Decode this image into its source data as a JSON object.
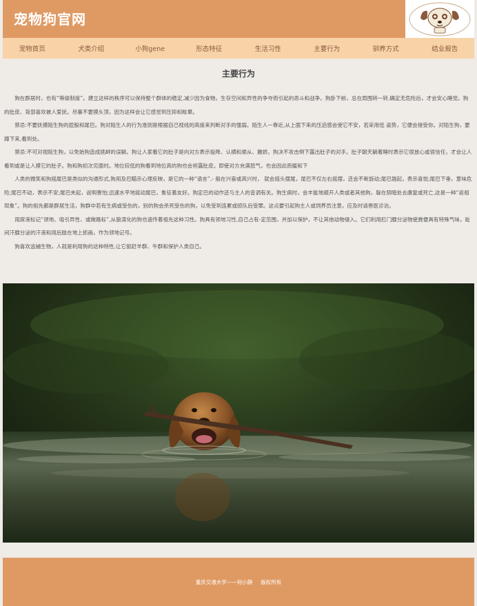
{
  "header": {
    "title": "宠物狗官网",
    "logo_icon": "dog-cartoon-logo"
  },
  "nav": {
    "items": [
      {
        "label": "宠物首页"
      },
      {
        "label": "犬类介绍"
      },
      {
        "label": "小狗gene"
      },
      {
        "label": "形态特征"
      },
      {
        "label": "生活习性"
      },
      {
        "label": "主要行为"
      },
      {
        "label": "驯养方式"
      },
      {
        "label": "结业报告"
      }
    ]
  },
  "main": {
    "title": "主要行为",
    "paragraphs": [
      "狗在群居时，也有“等级制度”。建立这样的秩序可以保持整个群体的稳定,减少因为食物，生存空间和异性的争夺而引起的恶斗和战争。狗卧下前，总在周围转一转,确定无危险后，才会安心睡觉。狗的肚皮、背部喜欢被人爱抚。尽量不要摸头顶，因为这样会让它感觉到压抑和眩晕。",
      "禁忌:不要抚摸陌生狗的屁股和尾巴。狗对陌生人的行为准则是根据自己视线的高度来判断对手的强弱。陌生人一靠近,从上面下来的压迫感会使它不安，若采用低 姿势，它便会接受你。对陌生狗，要蹲下来,看到处。",
      "禁忌:不可对视陌生狗，以免始狗造成挑衅的误解。狗让人家看它的肚子是向对方表示投降、认横和顺从、撒娇。狗决不攻击倒下露出肚子的对手。肚子朝天躺着睡时表示它很放心或很信任，才会让人看到或是让人摸它的肚子。狗和狗初次见面时。地位较低的狗看到地位高的狗也会袒露肚皮。即使对方充满怒气，也会因此而缓和下",
      "人类的微笑和狗摇尾巴是类似的沟通形式,狗用及巴瞄示心理反映，是它的一种“语言”,- 般在兴奋或高兴时， 就会摇头摆尾，尾巴不仅左右摇摆，还会不断旋动;尾巴翘起，表示喜悦;尾巴下垂，意味危险;尾巴不动，表示不安;尾巴夹起，说明害怕;迅速水平地摇动尾巴，象征着友好。狗定巴的动作还与主人的音调有关。狗生病时，会丰能地避开人类或者其他狗，躲在阴暗处去康复或死亡,这是一种“返祖现象”。狗的祖先都是群居生活，狗群中若有生病或受伤的，别的狗会杀死受伤的狗，以免受到连累或掠队后受罪。这点要引起狗主人或饲养员注意，应及时请兽医诊治。",
      "用尿液标记“领地、吸引异性、或做路标”,从狼演化的狗也遗传着祖先这种习性。狗具有领地习性,自己占有-定范围，并加以保护，不让其他动物侵入。它们利用肛门腺分泌物使粪便具有特殊气味，趾间汗腺分泌的汗液和用后肢在地上抓画，作为领地记号。",
      "狗喜欢追捕生物，人就是利用狗的这种特性,让它驱赶羊群、牛群和保护人类自己。"
    ]
  },
  "photo": {
    "icon": "dog-swimming-with-stick-photo"
  },
  "footer": {
    "author": "重庆交通大学——何小静",
    "rights": "版权所有"
  },
  "colors": {
    "header_bg": "#df9a64",
    "nav_bg": "#f8d3a8",
    "page_bg": "#efebe7",
    "footer_bg": "#df9a64"
  }
}
